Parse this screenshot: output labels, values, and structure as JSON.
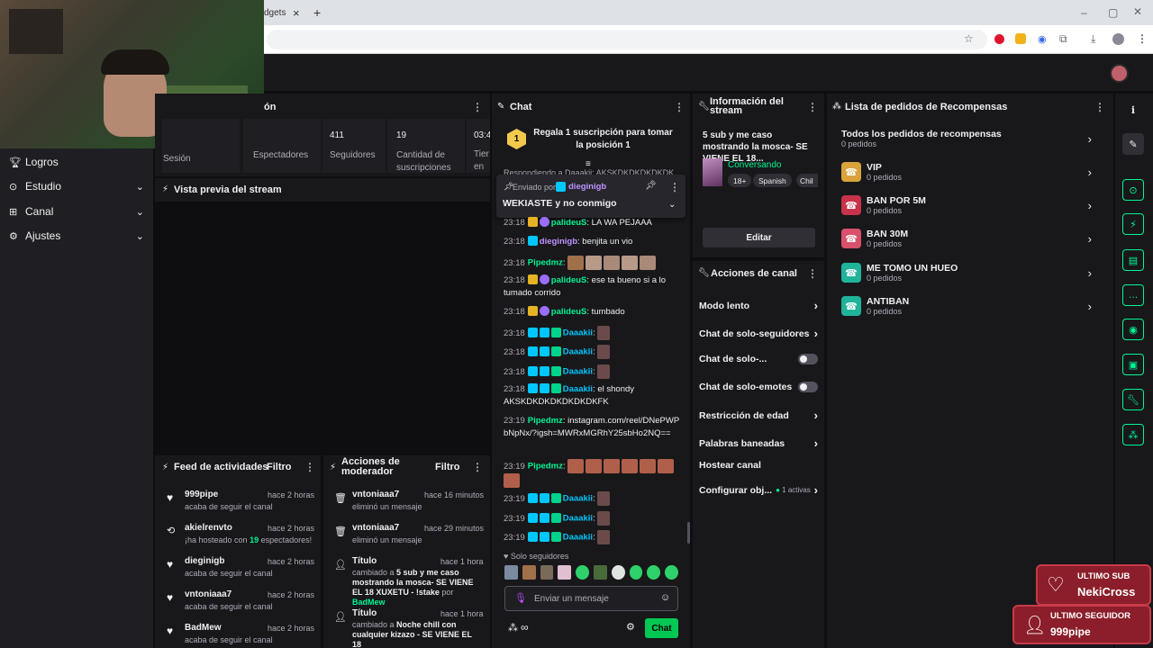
{
  "browser": {
    "tab_fragment": "dgets",
    "tab_close": "×",
    "new_tab": "+"
  },
  "sidebar": {
    "items": [
      {
        "label": "Logros",
        "icon": "trophy-icon"
      },
      {
        "label": "Estudio",
        "icon": "studio-icon"
      },
      {
        "label": "Canal",
        "icon": "channel-icon"
      },
      {
        "label": "Ajustes",
        "icon": "gear-icon"
      }
    ]
  },
  "stats": {
    "session_fragment": "ón",
    "session_label": "Sesión",
    "viewers_label": "Espectadores",
    "followers_value": "411",
    "followers_label": "Seguidores",
    "subs_value": "19",
    "subs_label": "Cantidad de suscripciones",
    "time_value": "03:4",
    "time_label": "Tier",
    "time_label2": "en v"
  },
  "preview": {
    "title": "Vista previa del stream"
  },
  "feed": {
    "title": "Feed de actividades",
    "filter": "Filtro",
    "items": [
      {
        "user": "999pipe",
        "time": "hace 2 horas",
        "desc": "acaba de seguir el canal"
      },
      {
        "user": "akielrenvto",
        "time": "hace 2 horas",
        "desc_pre": "¡ha hosteado con ",
        "desc_num": "19",
        "desc_post": " espectadores!"
      },
      {
        "user": "dieginigb",
        "time": "hace 2 horas",
        "desc": "acaba de seguir el canal"
      },
      {
        "user": "vntoniaaa7",
        "time": "hace 2 horas",
        "desc": "acaba de seguir el canal"
      },
      {
        "user": "BadMew",
        "time": "hace 2 horas",
        "desc": "acaba de seguir el canal"
      }
    ]
  },
  "mod": {
    "title": "Acciones de moderador",
    "filter": "Filtro",
    "items": [
      {
        "user": "vntoniaaa7",
        "time": "hace 16 minutos",
        "desc": "eliminó un mensaje"
      },
      {
        "user": "vntoniaaa7",
        "time": "hace 29 minutos",
        "desc": "eliminó un mensaje"
      },
      {
        "user": "Título",
        "time": "hace 1 hora",
        "desc_pre": "cambiado a ",
        "desc_bold": "5 sub y me caso mostrando la mosca- SE VIENE EL 18 XUXETU - !stake",
        "desc_post": " por ",
        "desc_by": "BadMew"
      },
      {
        "user": "Título",
        "time": "hace 1 hora",
        "desc_pre": "cambiado a ",
        "desc_bold": "Noche chill con cualquier kizazo - SE VIENE EL 18"
      }
    ]
  },
  "chat": {
    "title": "Chat",
    "gift_text": "Regala 1 suscripción para tomar la posición 1",
    "gift_rank": "1",
    "pinned_by_label": "Enviado por",
    "pinned_user": "dieginigb",
    "pinned_msg": "WEKIASTE y no conmigo",
    "reply_fragment": "Respondiendo a Daaakii: AKSKDKDKDKDKDK",
    "messages": [
      {
        "time": "23:18",
        "user": "palideuS",
        "text": "LA WA PEJAAA",
        "color": "#00f593"
      },
      {
        "time": "23:18",
        "user": "dieginigb",
        "text": "benjita un vio",
        "color": "#bf94ff"
      },
      {
        "time": "23:18",
        "user": "Pipedmz",
        "text": "",
        "color": "#00f593"
      },
      {
        "time": "23:18",
        "user": "palideuS",
        "text": "ese ta bueno si a lo tumado corrido",
        "color": "#00f593"
      },
      {
        "time": "23:18",
        "user": "palideuS",
        "text": "tumbado",
        "color": "#00f593"
      },
      {
        "time": "23:18",
        "user": "Daaakii",
        "text": "",
        "color": "#00c8ff"
      },
      {
        "time": "23:18",
        "user": "Daaakii",
        "text": "",
        "color": "#00c8ff"
      },
      {
        "time": "23:18",
        "user": "Daaakii",
        "text": "",
        "color": "#00c8ff"
      },
      {
        "time": "23:18",
        "user": "Daaakii",
        "text": "el shondy AKSKDKDKDKDKDKDKFK",
        "color": "#00c8ff"
      },
      {
        "time": "23:19",
        "user": "Pipedmz",
        "text": "instagram.com/reel/DNePWPbNpNx/?igsh=MWRxMGRhY25sbHo2NQ==",
        "color": "#00f593"
      },
      {
        "time": "23:19",
        "user": "Pipedmz",
        "text": "",
        "color": "#00f593"
      },
      {
        "time": "23:19",
        "user": "Daaakii",
        "text": "",
        "color": "#00c8ff"
      },
      {
        "time": "23:19",
        "user": "Daaakii",
        "text": "",
        "color": "#00c8ff"
      },
      {
        "time": "23:19",
        "user": "Daaakii",
        "text": "",
        "color": "#00c8ff"
      }
    ],
    "followers_only": "Solo seguidores",
    "input_placeholder": "Enviar un mensaje",
    "send_label": "Chat"
  },
  "stream_info": {
    "title": "Información del stream",
    "stream_title": "5 sub y me caso mostrando la mosca- SE VIENE EL 18...",
    "category": "Conversando",
    "tags": [
      "18+",
      "Spanish",
      "Chil"
    ],
    "edit_label": "Editar"
  },
  "channel_actions": {
    "title": "Acciones de canal",
    "items": [
      {
        "label": "Modo lento",
        "kind": "chevron"
      },
      {
        "label": "Chat de solo-seguidores",
        "kind": "chevron"
      },
      {
        "label": "Chat de solo-...",
        "kind": "toggle"
      },
      {
        "label": "Chat de solo-emotes",
        "kind": "toggle"
      },
      {
        "label": "Restricción de edad",
        "kind": "chevron"
      },
      {
        "label": "Palabras baneadas",
        "kind": "chevron"
      },
      {
        "label": "Hostear canal",
        "kind": "none"
      },
      {
        "label": "Configurar obj...",
        "kind": "chevron",
        "status": "1 activas"
      }
    ]
  },
  "rewards": {
    "title": "Lista de pedidos de Recompensas",
    "all_label": "Todos los pedidos de recompensas",
    "all_count": "0 pedidos",
    "items": [
      {
        "name": "VIP",
        "count": "0 pedidos",
        "color": "#d9a23a"
      },
      {
        "name": "BAN POR 5M",
        "count": "0 pedidos",
        "color": "#c8324a"
      },
      {
        "name": "BAN 30M",
        "count": "0 pedidos",
        "color": "#d8506a"
      },
      {
        "name": "ME TOMO UN HUEO",
        "count": "0 pedidos",
        "color": "#1fb39a"
      },
      {
        "name": "ANTIBAN",
        "count": "0 pedidos",
        "color": "#1fb39a"
      }
    ]
  },
  "overlay": {
    "last_sub_label": "ULTIMO SUB",
    "last_sub_name": "NekiCross",
    "last_follower_label": "ULTIMO SEGUIDOR",
    "last_follower_name": "999pipe"
  }
}
